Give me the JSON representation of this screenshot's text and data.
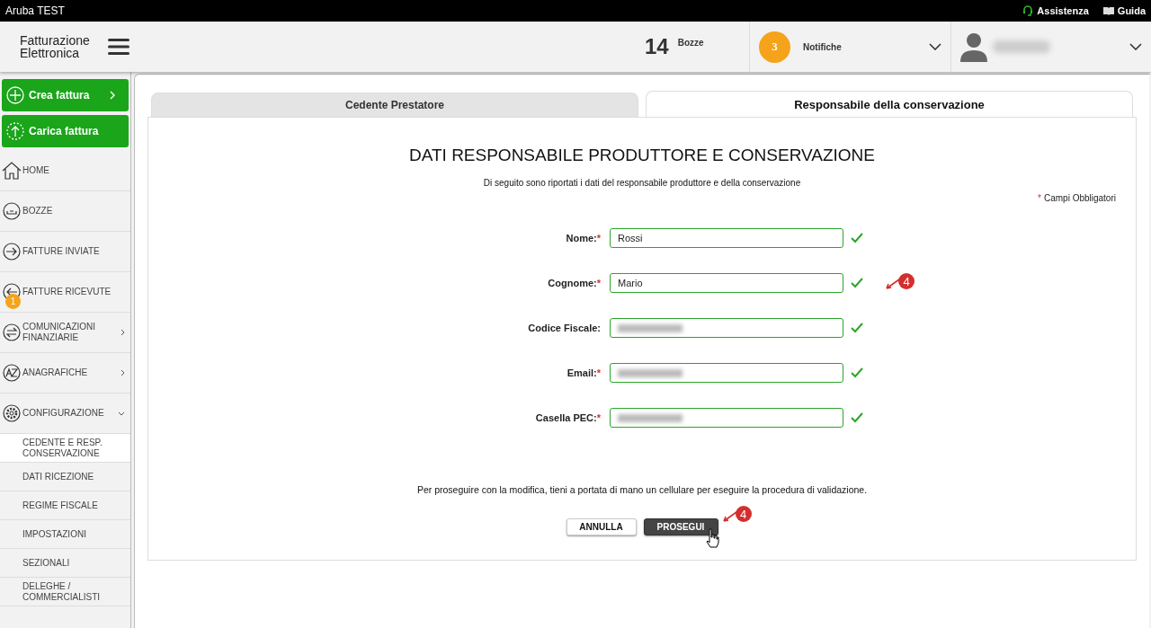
{
  "topbar": {
    "title": "Aruba TEST",
    "links": [
      {
        "label": "Assistenza",
        "kind": "headset"
      },
      {
        "label": "Guida",
        "kind": "book"
      }
    ]
  },
  "header": {
    "logo": [
      "Fatturazione",
      "Elettronica"
    ],
    "drafts_count": "14",
    "drafts_label": "Bozze",
    "notifications_count": "3",
    "notifications_label": "Notifiche"
  },
  "sidebar": {
    "actions": [
      {
        "label": "Crea fattura",
        "kind": "plus",
        "chevron": true
      },
      {
        "label": "Carica fattura",
        "kind": "upload",
        "chevron": false
      }
    ],
    "items": [
      {
        "label": "HOME",
        "kind": "home"
      },
      {
        "label": "BOZZE",
        "kind": "tray"
      },
      {
        "label": "FATTURE INVIATE",
        "kind": "out"
      },
      {
        "label": "FATTURE RICEVUTE",
        "kind": "in",
        "badge": "1"
      },
      {
        "label": "COMUNICAZIONI FINANZIARIE",
        "kind": "swap",
        "expanded": false
      },
      {
        "label": "ANAGRAFICHE",
        "kind": "az",
        "expanded": false
      },
      {
        "label": "CONFIGURAZIONE",
        "kind": "gear",
        "expanded": true,
        "children": [
          {
            "label": "CEDENTE E RESP. CONSERVAZIONE",
            "selected": true
          },
          {
            "label": "DATI RICEZIONE",
            "selected": false
          },
          {
            "label": "REGIME FISCALE",
            "selected": false
          },
          {
            "label": "IMPOSTAZIONI",
            "selected": false
          },
          {
            "label": "SEZIONALI",
            "selected": false
          },
          {
            "label": "DELEGHE / COMMERCIALISTI",
            "selected": false
          }
        ]
      }
    ]
  },
  "tabs": [
    {
      "label": "Cedente Prestatore",
      "selected": false
    },
    {
      "label": "Responsabile della conservazione",
      "selected": true
    }
  ],
  "form": {
    "title": "DATI RESPONSABILE PRODUTTORE E CONSERVAZIONE",
    "subtitle": "Di seguito sono riportati i dati del responsabile produttore e della conservazione",
    "required_mark": "*",
    "required_note": "Campi Obbligatori",
    "fields": [
      {
        "label": "Nome:",
        "required": true,
        "value": "Rossi",
        "redacted": false,
        "valid": true
      },
      {
        "label": "Cognome:",
        "required": true,
        "value": "Mario",
        "redacted": false,
        "valid": true
      },
      {
        "label": "Codice Fiscale:",
        "required": false,
        "redacted": true,
        "valid": true
      },
      {
        "label": "Email:",
        "required": true,
        "redacted": true,
        "valid": true
      },
      {
        "label": "Casella PEC:",
        "required": true,
        "redacted": true,
        "valid": true
      }
    ],
    "notice": "Per proseguire con la modifica, tieni a portata di mano un cellulare per eseguire la procedura di validazione.",
    "buttons": [
      {
        "label": "ANNULLA",
        "kind": "secondary"
      },
      {
        "label": "PROSEGUI",
        "kind": "primary"
      }
    ]
  },
  "annotations": [
    {
      "label": "4"
    },
    {
      "label": "4"
    }
  ]
}
